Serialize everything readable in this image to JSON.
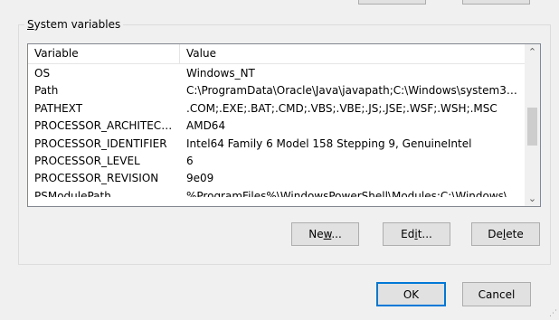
{
  "system_variables": {
    "group_label_prefix": "S",
    "group_label_rest": "ystem variables",
    "columns": {
      "variable": "Variable",
      "value": "Value"
    },
    "rows": [
      {
        "name": "OS",
        "value": "Windows_NT"
      },
      {
        "name": "Path",
        "value": "C:\\ProgramData\\Oracle\\Java\\javapath;C:\\Windows\\system32;..."
      },
      {
        "name": "PATHEXT",
        "value": ".COM;.EXE;.BAT;.CMD;.VBS;.VBE;.JS;.JSE;.WSF;.WSH;.MSC"
      },
      {
        "name": "PROCESSOR_ARCHITECTU...",
        "value": "AMD64"
      },
      {
        "name": "PROCESSOR_IDENTIFIER",
        "value": "Intel64 Family 6 Model 158 Stepping 9, GenuineIntel"
      },
      {
        "name": "PROCESSOR_LEVEL",
        "value": "6"
      },
      {
        "name": "PROCESSOR_REVISION",
        "value": "9e09"
      },
      {
        "name": "PSModulePath",
        "value": "%ProgramFiles%\\WindowsPowerShell\\Modules;C:\\Windows\\..."
      }
    ],
    "scroll_up_glyph": "⌃",
    "scroll_down_glyph": "⌄",
    "buttons": {
      "new_a": "Ne",
      "new_u": "w",
      "new_b": "...",
      "edit_a": "Ed",
      "edit_u": "i",
      "edit_b": "t...",
      "delete_a": "De",
      "delete_u": "l",
      "delete_b": "ete"
    }
  },
  "dialog_buttons": {
    "ok": "OK",
    "cancel": "Cancel"
  }
}
